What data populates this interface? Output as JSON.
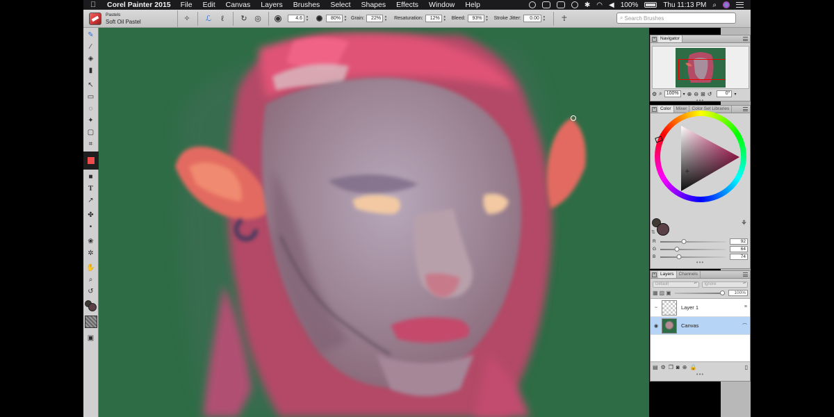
{
  "menubar": {
    "app_name": "Corel Painter 2015",
    "menus": [
      "File",
      "Edit",
      "Canvas",
      "Layers",
      "Brushes",
      "Select",
      "Shapes",
      "Effects",
      "Window",
      "Help"
    ],
    "battery": "100%",
    "clock": "Thu 11:13 PM"
  },
  "propbar": {
    "brush_category": "Pastels",
    "brush_variant": "Soft Oil Pastel",
    "size": "4.6",
    "opacity": "80%",
    "grain_label": "Grain:",
    "grain": "22%",
    "resaturation_label": "Resaturation:",
    "resaturation": "12%",
    "bleed_label": "Bleed:",
    "bleed": "93%",
    "jitter_label": "Stroke Jitter:",
    "jitter": "0.00",
    "search_placeholder": "Search Brushes"
  },
  "navigator": {
    "title": "Navigator",
    "zoom": "100%",
    "rotation": "0°"
  },
  "color_panel": {
    "tabs": [
      "Color",
      "Mixer",
      "Color Set Libraries"
    ],
    "main_color": "#5c4048",
    "additional_color": "#3f3a33",
    "brush_color_tool": "#f04b4b",
    "r": 92,
    "g": 64,
    "b": 74
  },
  "layers_panel": {
    "tabs": [
      "Layers",
      "Channels"
    ],
    "composite_method": "Default",
    "preserve": "Ignore",
    "opacity": "100%",
    "layers": [
      {
        "name": "Layer 1",
        "visible": false,
        "selected": false
      },
      {
        "name": "Canvas",
        "visible": true,
        "selected": true
      }
    ]
  },
  "canvas": {
    "background_color": "#2e6c46"
  }
}
